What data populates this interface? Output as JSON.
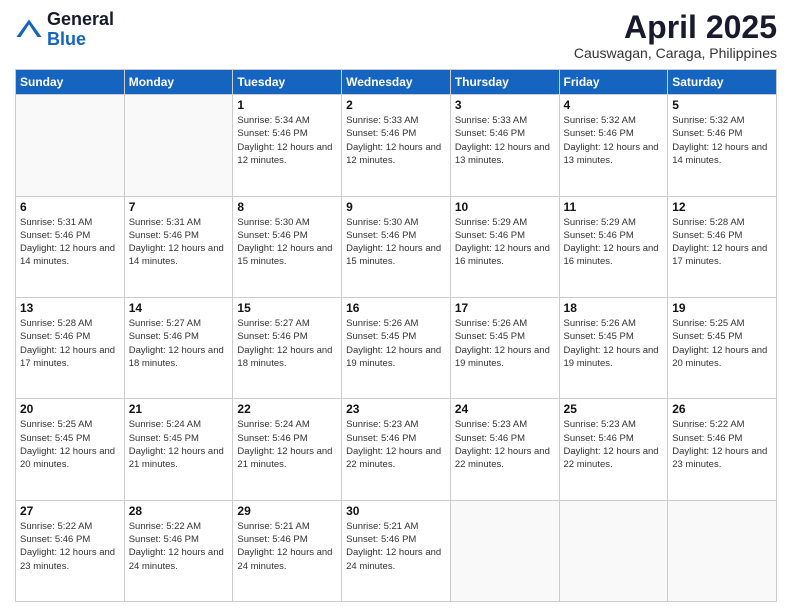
{
  "header": {
    "logo_general": "General",
    "logo_blue": "Blue",
    "month_title": "April 2025",
    "location": "Causwagan, Caraga, Philippines"
  },
  "days_of_week": [
    "Sunday",
    "Monday",
    "Tuesday",
    "Wednesday",
    "Thursday",
    "Friday",
    "Saturday"
  ],
  "weeks": [
    [
      {
        "day": "",
        "info": ""
      },
      {
        "day": "",
        "info": ""
      },
      {
        "day": "1",
        "info": "Sunrise: 5:34 AM\nSunset: 5:46 PM\nDaylight: 12 hours\nand 12 minutes."
      },
      {
        "day": "2",
        "info": "Sunrise: 5:33 AM\nSunset: 5:46 PM\nDaylight: 12 hours\nand 12 minutes."
      },
      {
        "day": "3",
        "info": "Sunrise: 5:33 AM\nSunset: 5:46 PM\nDaylight: 12 hours\nand 13 minutes."
      },
      {
        "day": "4",
        "info": "Sunrise: 5:32 AM\nSunset: 5:46 PM\nDaylight: 12 hours\nand 13 minutes."
      },
      {
        "day": "5",
        "info": "Sunrise: 5:32 AM\nSunset: 5:46 PM\nDaylight: 12 hours\nand 14 minutes."
      }
    ],
    [
      {
        "day": "6",
        "info": "Sunrise: 5:31 AM\nSunset: 5:46 PM\nDaylight: 12 hours\nand 14 minutes."
      },
      {
        "day": "7",
        "info": "Sunrise: 5:31 AM\nSunset: 5:46 PM\nDaylight: 12 hours\nand 14 minutes."
      },
      {
        "day": "8",
        "info": "Sunrise: 5:30 AM\nSunset: 5:46 PM\nDaylight: 12 hours\nand 15 minutes."
      },
      {
        "day": "9",
        "info": "Sunrise: 5:30 AM\nSunset: 5:46 PM\nDaylight: 12 hours\nand 15 minutes."
      },
      {
        "day": "10",
        "info": "Sunrise: 5:29 AM\nSunset: 5:46 PM\nDaylight: 12 hours\nand 16 minutes."
      },
      {
        "day": "11",
        "info": "Sunrise: 5:29 AM\nSunset: 5:46 PM\nDaylight: 12 hours\nand 16 minutes."
      },
      {
        "day": "12",
        "info": "Sunrise: 5:28 AM\nSunset: 5:46 PM\nDaylight: 12 hours\nand 17 minutes."
      }
    ],
    [
      {
        "day": "13",
        "info": "Sunrise: 5:28 AM\nSunset: 5:46 PM\nDaylight: 12 hours\nand 17 minutes."
      },
      {
        "day": "14",
        "info": "Sunrise: 5:27 AM\nSunset: 5:46 PM\nDaylight: 12 hours\nand 18 minutes."
      },
      {
        "day": "15",
        "info": "Sunrise: 5:27 AM\nSunset: 5:46 PM\nDaylight: 12 hours\nand 18 minutes."
      },
      {
        "day": "16",
        "info": "Sunrise: 5:26 AM\nSunset: 5:45 PM\nDaylight: 12 hours\nand 19 minutes."
      },
      {
        "day": "17",
        "info": "Sunrise: 5:26 AM\nSunset: 5:45 PM\nDaylight: 12 hours\nand 19 minutes."
      },
      {
        "day": "18",
        "info": "Sunrise: 5:26 AM\nSunset: 5:45 PM\nDaylight: 12 hours\nand 19 minutes."
      },
      {
        "day": "19",
        "info": "Sunrise: 5:25 AM\nSunset: 5:45 PM\nDaylight: 12 hours\nand 20 minutes."
      }
    ],
    [
      {
        "day": "20",
        "info": "Sunrise: 5:25 AM\nSunset: 5:45 PM\nDaylight: 12 hours\nand 20 minutes."
      },
      {
        "day": "21",
        "info": "Sunrise: 5:24 AM\nSunset: 5:45 PM\nDaylight: 12 hours\nand 21 minutes."
      },
      {
        "day": "22",
        "info": "Sunrise: 5:24 AM\nSunset: 5:46 PM\nDaylight: 12 hours\nand 21 minutes."
      },
      {
        "day": "23",
        "info": "Sunrise: 5:23 AM\nSunset: 5:46 PM\nDaylight: 12 hours\nand 22 minutes."
      },
      {
        "day": "24",
        "info": "Sunrise: 5:23 AM\nSunset: 5:46 PM\nDaylight: 12 hours\nand 22 minutes."
      },
      {
        "day": "25",
        "info": "Sunrise: 5:23 AM\nSunset: 5:46 PM\nDaylight: 12 hours\nand 22 minutes."
      },
      {
        "day": "26",
        "info": "Sunrise: 5:22 AM\nSunset: 5:46 PM\nDaylight: 12 hours\nand 23 minutes."
      }
    ],
    [
      {
        "day": "27",
        "info": "Sunrise: 5:22 AM\nSunset: 5:46 PM\nDaylight: 12 hours\nand 23 minutes."
      },
      {
        "day": "28",
        "info": "Sunrise: 5:22 AM\nSunset: 5:46 PM\nDaylight: 12 hours\nand 24 minutes."
      },
      {
        "day": "29",
        "info": "Sunrise: 5:21 AM\nSunset: 5:46 PM\nDaylight: 12 hours\nand 24 minutes."
      },
      {
        "day": "30",
        "info": "Sunrise: 5:21 AM\nSunset: 5:46 PM\nDaylight: 12 hours\nand 24 minutes."
      },
      {
        "day": "",
        "info": ""
      },
      {
        "day": "",
        "info": ""
      },
      {
        "day": "",
        "info": ""
      }
    ]
  ]
}
